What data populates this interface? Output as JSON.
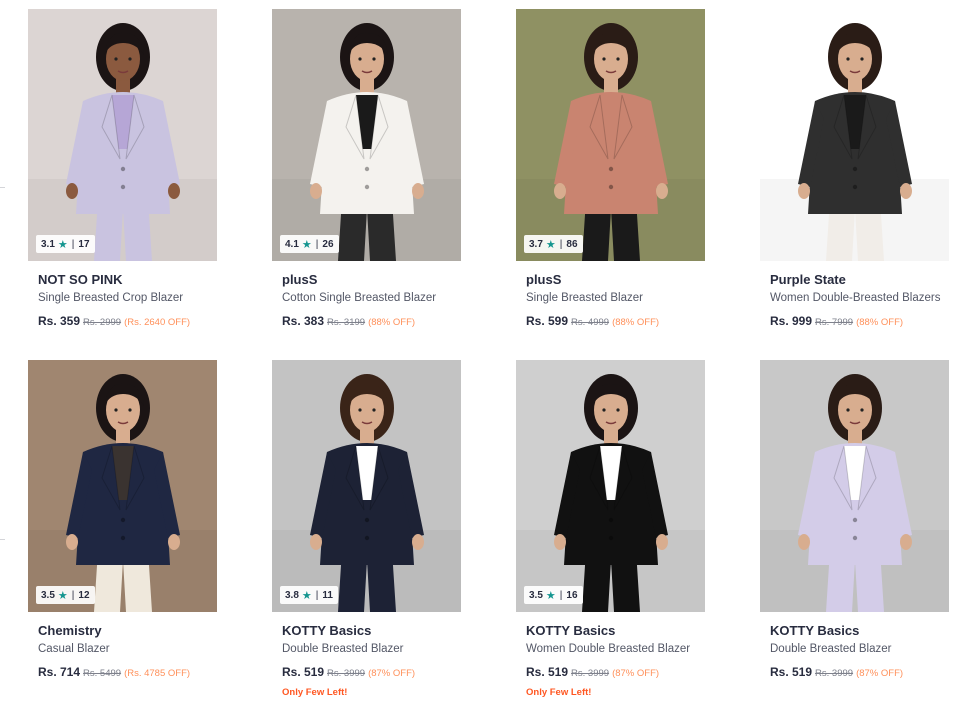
{
  "products": [
    {
      "brand": "NOT SO PINK",
      "name": "Single Breasted Crop Blazer",
      "rating": "3.1",
      "rating_count": "17",
      "price": "Rs. 359",
      "mrp": "Rs. 2999",
      "discount": "(Rs. 2640 OFF)",
      "few_left": "",
      "bg": "#dcd5d3",
      "garment": "#c9c3e0",
      "top": "#b6a6d6",
      "pants": "#c9c3e0",
      "skin": "#8b5a3f",
      "hair": "#1b1414"
    },
    {
      "brand": "plusS",
      "name": "Cotton Single Breasted Blazer",
      "rating": "4.1",
      "rating_count": "26",
      "price": "Rs. 383",
      "mrp": "Rs. 3199",
      "discount": "(88% OFF)",
      "few_left": "",
      "bg": "#b8b3ad",
      "garment": "#f4f2ee",
      "top": "#1a1a1a",
      "pants": "#2a2a2a",
      "skin": "#d8ad8f",
      "hair": "#1b1414"
    },
    {
      "brand": "plusS",
      "name": "Single Breasted Blazer",
      "rating": "3.7",
      "rating_count": "86",
      "price": "Rs. 599",
      "mrp": "Rs. 4999",
      "discount": "(88% OFF)",
      "few_left": "",
      "bg": "#8f9163",
      "garment": "#c98470",
      "top": "#c98470",
      "pants": "#1a1a1a",
      "skin": "#d8ad8f",
      "hair": "#2a1c16"
    },
    {
      "brand": "Purple State",
      "name": "Women Double-Breasted Blazers",
      "rating": "",
      "rating_count": "",
      "price": "Rs. 999",
      "mrp": "Rs. 7999",
      "discount": "(88% OFF)",
      "few_left": "",
      "bg": "#ffffff",
      "garment": "#2f2f2f",
      "top": "#1a1a1a",
      "pants": "#f1ede8",
      "skin": "#d8ad8f",
      "hair": "#2a1c16"
    },
    {
      "brand": "Chemistry",
      "name": "Casual Blazer",
      "rating": "3.5",
      "rating_count": "12",
      "price": "Rs. 714",
      "mrp": "Rs. 5499",
      "discount": "(Rs. 4785 OFF)",
      "few_left": "",
      "bg": "#a08670",
      "garment": "#1f2742",
      "top": "#3a3330",
      "pants": "#efe8dc",
      "skin": "#d8ad8f",
      "hair": "#1b1414"
    },
    {
      "brand": "KOTTY Basics",
      "name": "Double Breasted Blazer",
      "rating": "3.8",
      "rating_count": "11",
      "price": "Rs. 519",
      "mrp": "Rs. 3999",
      "discount": "(87% OFF)",
      "few_left": "Only Few Left!",
      "bg": "#c3c3c3",
      "garment": "#1d2235",
      "top": "#ffffff",
      "pants": "#1d2235",
      "skin": "#d8ad8f",
      "hair": "#3a2418"
    },
    {
      "brand": "KOTTY Basics",
      "name": "Women Double Breasted Blazer",
      "rating": "3.5",
      "rating_count": "16",
      "price": "Rs. 519",
      "mrp": "Rs. 3999",
      "discount": "(87% OFF)",
      "few_left": "Only Few Left!",
      "bg": "#cfcfcf",
      "garment": "#111111",
      "top": "#ffffff",
      "pants": "#111111",
      "skin": "#d8ad8f",
      "hair": "#1b1414"
    },
    {
      "brand": "KOTTY Basics",
      "name": "Double Breasted Blazer",
      "rating": "",
      "rating_count": "",
      "price": "Rs. 519",
      "mrp": "Rs. 3999",
      "discount": "(87% OFF)",
      "few_left": "",
      "bg": "#c8c8c8",
      "garment": "#d3cce8",
      "top": "#ffffff",
      "pants": "#d3cce8",
      "skin": "#d8ad8f",
      "hair": "#2a1c16"
    }
  ]
}
